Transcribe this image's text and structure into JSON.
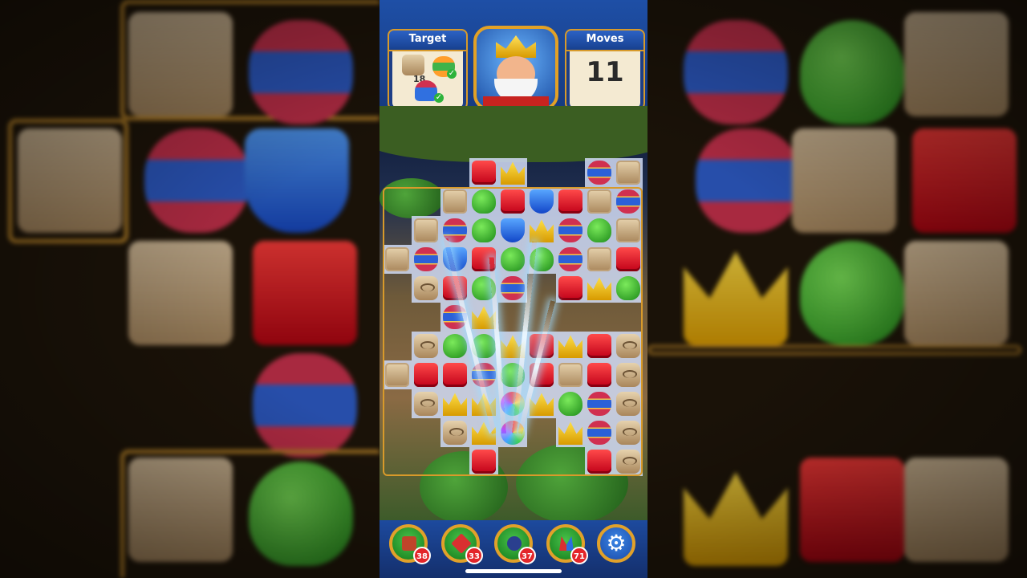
{
  "hud": {
    "target_label": "Target",
    "moves_label": "Moves",
    "moves_value": "11",
    "target_crate_count": "18",
    "target_egg_done": "✓",
    "target_helmet_done": "✓"
  },
  "boosters": [
    {
      "name": "hammer",
      "count": "38"
    },
    {
      "name": "arrow",
      "count": "33"
    },
    {
      "name": "cannon",
      "count": "37"
    },
    {
      "name": "jester-hat",
      "count": "71"
    }
  ],
  "settings_icon": "⚙",
  "colors": {
    "frame": "#d89a2a",
    "topbar": "#1e4fa6",
    "booster_count": "#e3262a"
  }
}
